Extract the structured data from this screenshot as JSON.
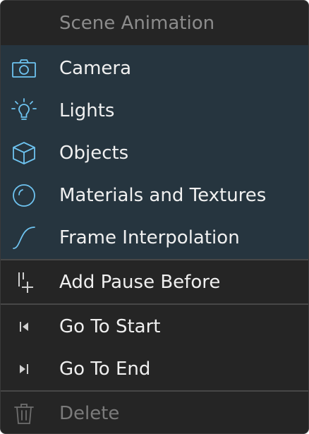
{
  "menu": {
    "title": "Scene Animation",
    "accent_color": "#6ec3f0",
    "highlight_bg": "#26353f",
    "items": [
      {
        "label": "Camera",
        "icon": "camera-icon"
      },
      {
        "label": "Lights",
        "icon": "lightbulb-icon"
      },
      {
        "label": "Objects",
        "icon": "cube-icon"
      },
      {
        "label": "Materials and Textures",
        "icon": "material-sphere-icon"
      },
      {
        "label": "Frame Interpolation",
        "icon": "interpolation-curve-icon"
      }
    ],
    "actions": {
      "add_pause_before": "Add Pause Before",
      "go_to_start": "Go To Start",
      "go_to_end": "Go To End",
      "delete": "Delete"
    }
  }
}
